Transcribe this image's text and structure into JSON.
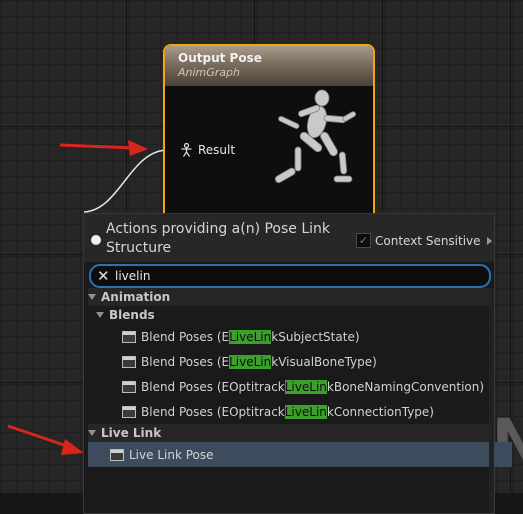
{
  "node": {
    "title": "Output Pose",
    "subtitle": "AnimGraph",
    "pin_label": "Result",
    "pin_icon": "pose-pin-icon",
    "border_color": "#f2a60d"
  },
  "background_text": "N",
  "menu": {
    "title": "Actions providing a(n) Pose Link Structure",
    "context_label": "Context Sensitive",
    "context_checked": true,
    "search_value": "livelin",
    "categories": [
      {
        "label": "Animation",
        "subcategories": [
          {
            "label": "Blends",
            "items": [
              {
                "pre": "Blend Poses (E",
                "hl": "LiveLin",
                "post": "kSubjectState)"
              },
              {
                "pre": "Blend Poses (E",
                "hl": "LiveLin",
                "post": "kVisualBoneType)"
              },
              {
                "pre": "Blend Poses (EOptitrack",
                "hl": "LiveLin",
                "post": "kBoneNamingConvention)"
              },
              {
                "pre": "Blend Poses (EOptitrack",
                "hl": "LiveLin",
                "post": "kConnectionType)"
              }
            ]
          }
        ]
      },
      {
        "label": "Live Link",
        "items": [
          {
            "label": "Live Link Pose",
            "selected": true
          }
        ]
      }
    ],
    "highlight_color": "#3ca12b",
    "accent_color": "#2f6fb8"
  }
}
